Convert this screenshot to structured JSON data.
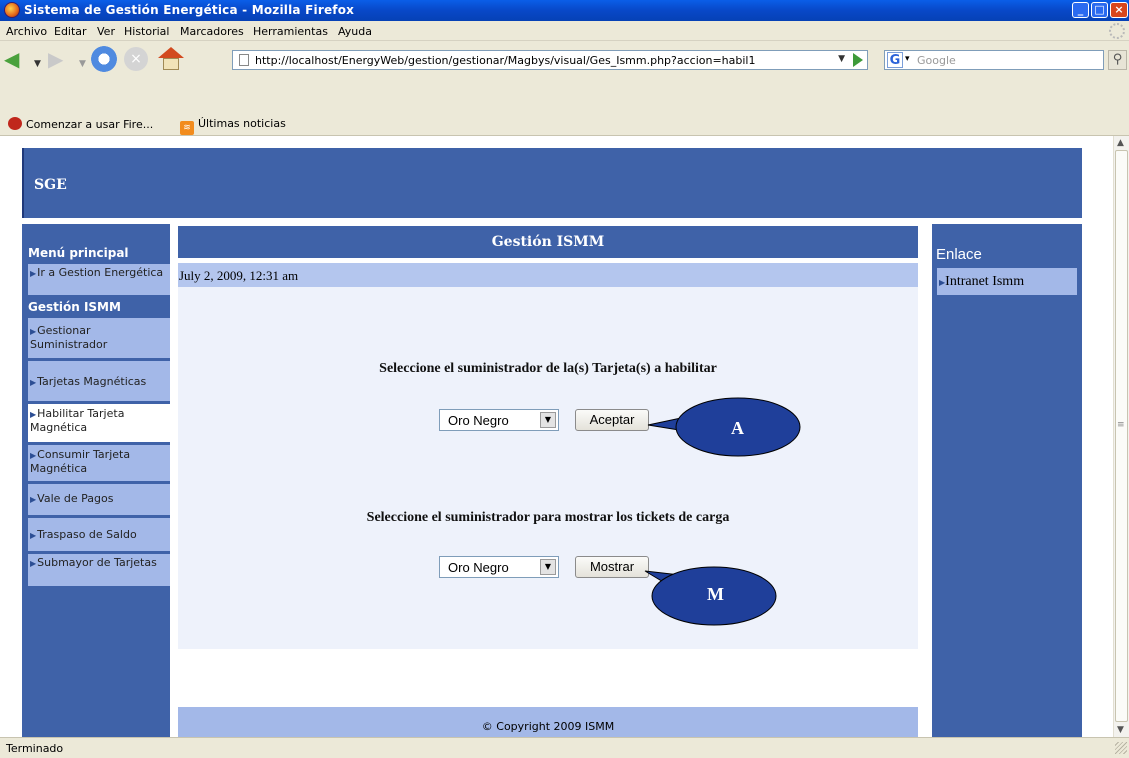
{
  "window": {
    "title": "Sistema de Gestión Energética - Mozilla Firefox"
  },
  "menubar": [
    "Archivo",
    "Editar",
    "Ver",
    "Historial",
    "Marcadores",
    "Herramientas",
    "Ayuda"
  ],
  "toolbar": {
    "url": "http://localhost/EnergyWeb/gestion/gestionar/Magbys/visual/Ges_Ismm.php?accion=habil1",
    "search_placeholder": "Google"
  },
  "bookmarks": [
    "Comenzar a usar Fire...",
    "Últimas noticias"
  ],
  "page": {
    "header": "SGE",
    "left_menu": {
      "heading_main": "Menú principal",
      "heading_section": "Gestión ISMM",
      "items": [
        {
          "label": "Ir a Gestion Energética"
        },
        {
          "label": "Gestionar Suministrador"
        },
        {
          "label": "Tarjetas Magnéticas"
        },
        {
          "label": "Habilitar Tarjeta Magnética",
          "active": true
        },
        {
          "label": "Consumir Tarjeta Magnética"
        },
        {
          "label": "Vale de Pagos"
        },
        {
          "label": "Traspaso de Saldo"
        },
        {
          "label": "Submayor de Tarjetas"
        }
      ]
    },
    "center": {
      "title": "Gestión ISMM",
      "date": "July 2, 2009, 12:31 am",
      "form1": {
        "prompt": "Seleccione el suministrador de la(s) Tarjeta(s) a habilitar",
        "selected": "Oro Negro",
        "button": "Aceptar",
        "callout": "A"
      },
      "form2": {
        "prompt": "Seleccione el suministrador para mostrar los tickets de carga",
        "selected": "Oro Negro",
        "button": "Mostrar",
        "callout": "M"
      },
      "footer": "© Copyright 2009 ISMM"
    },
    "right": {
      "heading": "Enlace",
      "link": "Intranet Ismm"
    }
  },
  "status": "Terminado",
  "colors": {
    "accent": "#3f62a8",
    "light": "#a3b8e8",
    "callout": "#1f3f9a"
  }
}
